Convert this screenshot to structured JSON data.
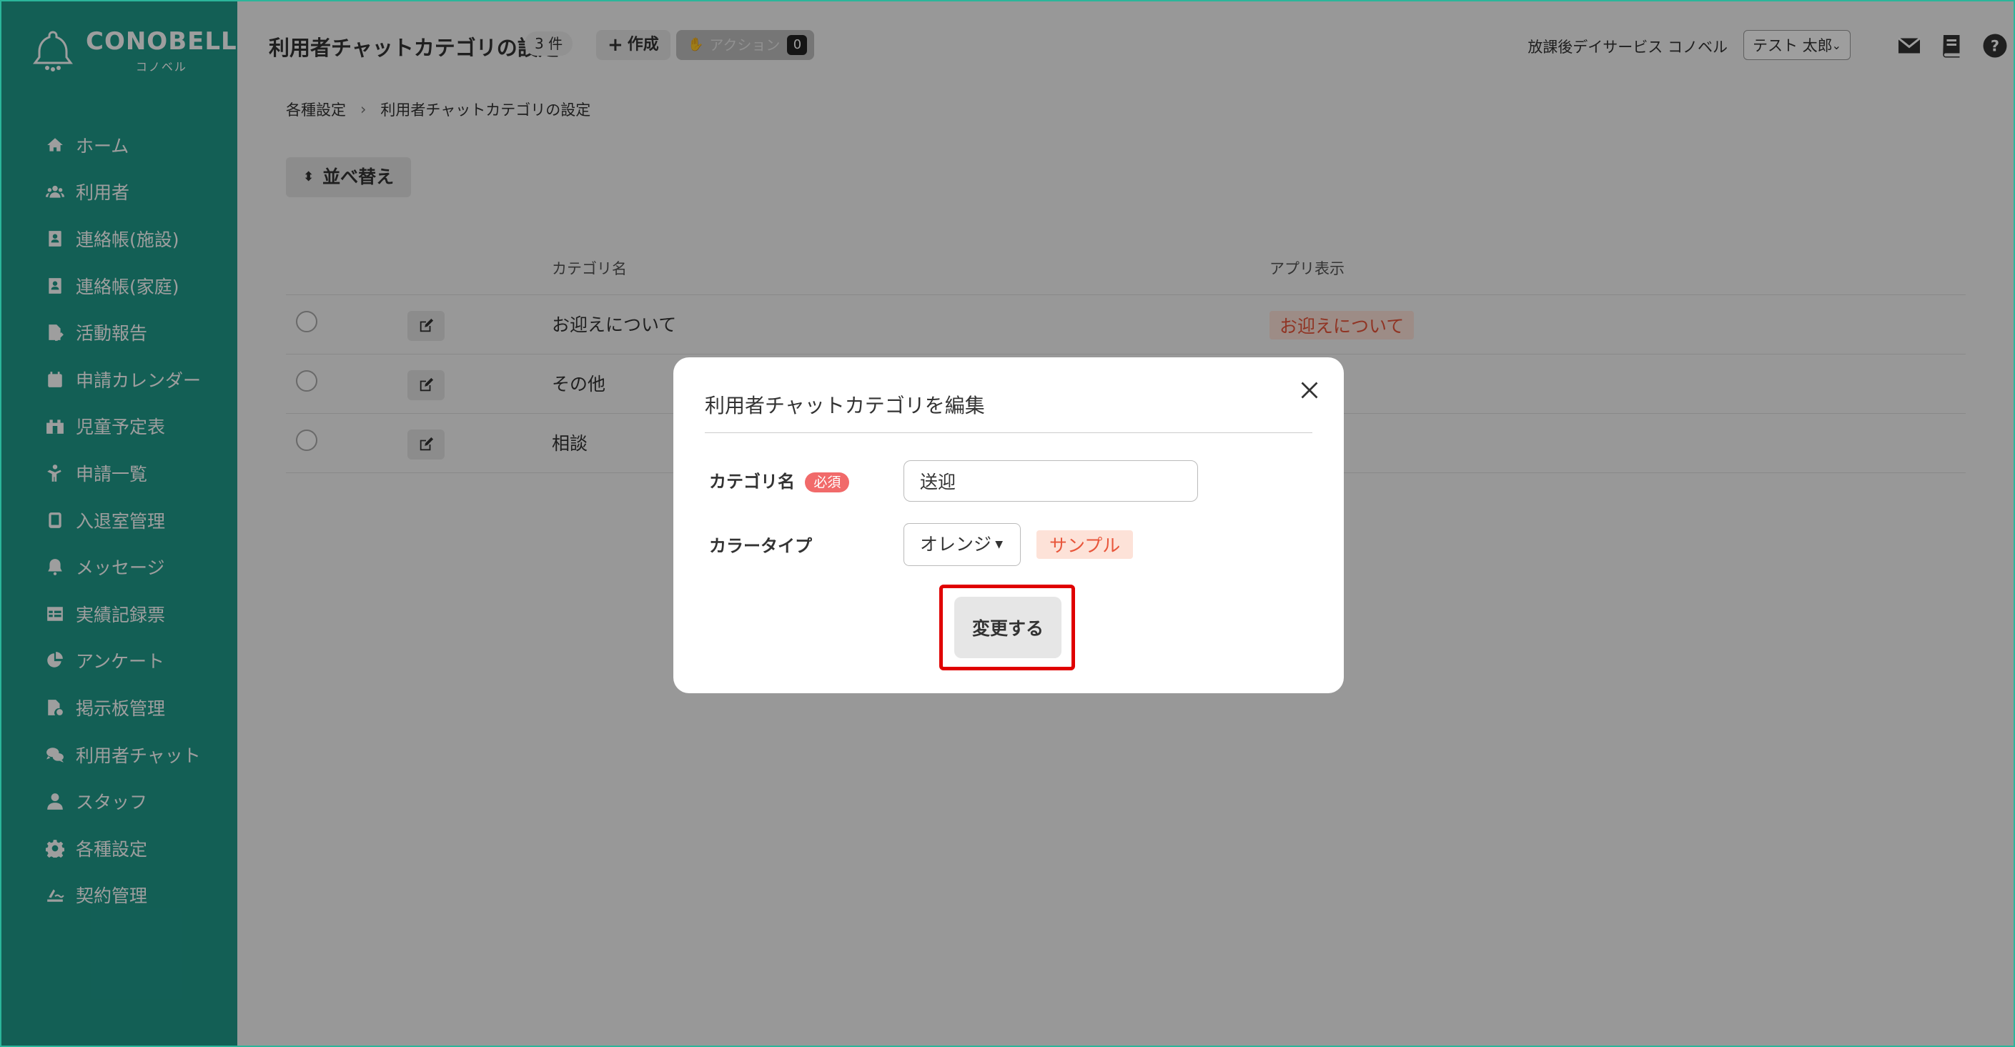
{
  "brand": {
    "name": "CONOBELL",
    "sub": "コノベル"
  },
  "sidebar": {
    "items": [
      {
        "label": "ホーム",
        "icon": "home-icon"
      },
      {
        "label": "利用者",
        "icon": "users-icon"
      },
      {
        "label": "連絡帳(施設)",
        "icon": "contact-book-icon"
      },
      {
        "label": "連絡帳(家庭)",
        "icon": "contact-book-icon"
      },
      {
        "label": "活動報告",
        "icon": "report-icon"
      },
      {
        "label": "申請カレンダー",
        "icon": "calendar-icon"
      },
      {
        "label": "児童予定表",
        "icon": "schedule-icon"
      },
      {
        "label": "申請一覧",
        "icon": "child-icon"
      },
      {
        "label": "入退室管理",
        "icon": "tablet-icon"
      },
      {
        "label": "メッセージ",
        "icon": "bell-icon"
      },
      {
        "label": "実績記録票",
        "icon": "table-icon"
      },
      {
        "label": "アンケート",
        "icon": "pie-chart-icon"
      },
      {
        "label": "掲示板管理",
        "icon": "board-icon"
      },
      {
        "label": "利用者チャット",
        "icon": "chat-icon"
      },
      {
        "label": "スタッフ",
        "icon": "staff-icon"
      },
      {
        "label": "各種設定",
        "icon": "gear-icon"
      },
      {
        "label": "契約管理",
        "icon": "contract-icon"
      }
    ]
  },
  "header": {
    "title": "利用者チャットカテゴリの設定",
    "count": "3 件",
    "create_label": "作成",
    "action_label": "アクション",
    "action_count": "0",
    "facility": "放課後デイサービス コノベル",
    "user": "テスト 太郎"
  },
  "breadcrumb": {
    "parent": "各種設定",
    "current": "利用者チャットカテゴリの設定"
  },
  "toolbar": {
    "sort_label": "並べ替え"
  },
  "table": {
    "headers": {
      "name": "カテゴリ名",
      "app": "アプリ表示"
    },
    "rows": [
      {
        "name": "お迎えについて",
        "tag": "お迎えについて"
      },
      {
        "name": "その他",
        "tag": ""
      },
      {
        "name": "相談",
        "tag": ""
      }
    ]
  },
  "modal": {
    "title": "利用者チャットカテゴリを編集",
    "name_label": "カテゴリ名",
    "required": "必須",
    "name_value": "送迎",
    "color_label": "カラータイプ",
    "color_value": "オレンジ",
    "sample": "サンプル",
    "submit": "変更する"
  },
  "colors": {
    "sidebar": "#1f9a8a",
    "accent_tag_bg": "#fde2d8",
    "accent_tag_text": "#e8553a",
    "required": "#f16a6a",
    "highlight": "#e00000"
  }
}
